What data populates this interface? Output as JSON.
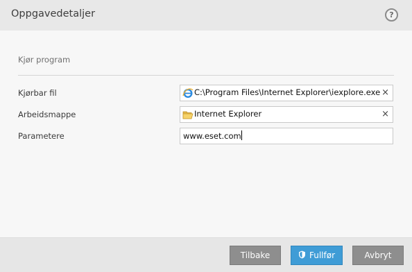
{
  "window": {
    "title": "Oppgavedetaljer",
    "help_label": "?"
  },
  "section": {
    "title": "Kjør program"
  },
  "fields": {
    "executable": {
      "label": "Kjørbar fil",
      "value": "C:\\Program Files\\Internet Explorer\\iexplore.exe",
      "icon": "internet-explorer-icon",
      "clear_label": "×"
    },
    "working_dir": {
      "label": "Arbeidsmappe",
      "value": "Internet Explorer",
      "icon": "folder-icon",
      "clear_label": "×"
    },
    "parameters": {
      "label": "Parametere",
      "value": "www.eset.com"
    }
  },
  "buttons": {
    "back": "Tilbake",
    "finish": "Fullfør",
    "cancel": "Avbryt"
  },
  "colors": {
    "primary_button": "#3f9cd6",
    "secondary_button": "#8e8e8e"
  }
}
